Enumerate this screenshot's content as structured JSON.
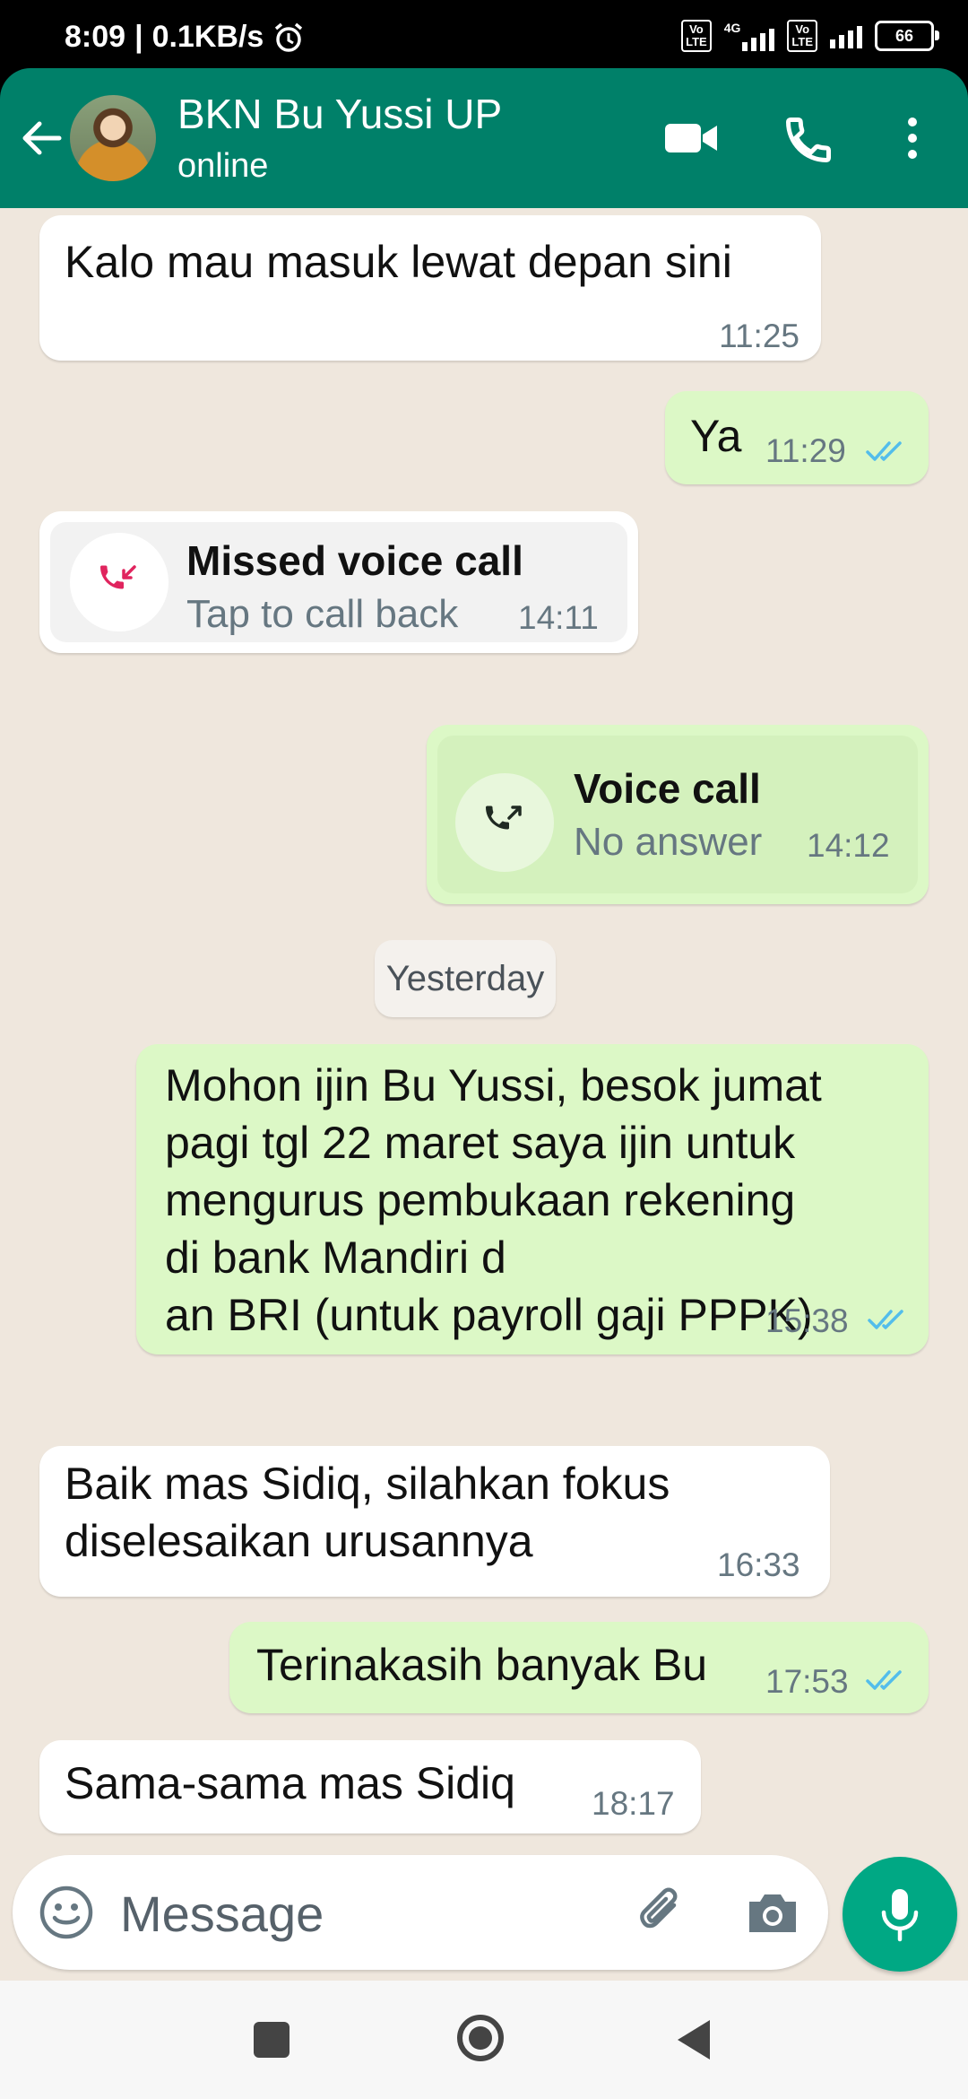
{
  "status_bar": {
    "time": "8:09",
    "speed": "0.1KB/s",
    "network": "4G",
    "volte1": "Vo\nLTE",
    "volte2": "Vo\nLTE",
    "battery": "66"
  },
  "header": {
    "contact_name": "BKN Bu Yussi UP",
    "contact_status": "online",
    "icons": [
      "back-arrow-icon",
      "video-call-icon",
      "voice-call-icon",
      "more-options-icon"
    ]
  },
  "messages": [
    {
      "direction": "in",
      "text": "Kalo mau masuk lewat depan sini",
      "time": "11:25"
    },
    {
      "direction": "out",
      "text": "Ya",
      "time": "11:29",
      "status": "read"
    },
    {
      "direction": "in",
      "type": "call",
      "title": "Missed voice call",
      "subtitle": "Tap to call back",
      "time": "14:11"
    },
    {
      "direction": "out",
      "type": "call",
      "title": "Voice call",
      "subtitle": "No answer",
      "time": "14:12"
    },
    {
      "direction": "out",
      "text": "Mohon ijin Bu Yussi, besok jumat\npagi tgl 22 maret saya ijin untuk\nmengurus pembukaan rekening\ndi bank Mandiri d\nan BRI (untuk payroll gaji PPPK)",
      "time": "15:38",
      "status": "read"
    },
    {
      "direction": "in",
      "text": "Baik mas Sidiq, silahkan fokus\ndiselesaikan urusannya",
      "time": "16:33"
    },
    {
      "direction": "out",
      "text": "Terinakasih banyak Bu",
      "time": "17:53",
      "status": "read"
    },
    {
      "direction": "in",
      "text": "Sama-sama mas Sidiq",
      "time": "18:17"
    }
  ],
  "date_separator": "Yesterday",
  "composer": {
    "placeholder": "Message",
    "icons": [
      "emoji-icon",
      "attach-icon",
      "camera-icon",
      "mic-icon"
    ]
  },
  "colors": {
    "header": "#008069",
    "chat_background": "#efe7dd",
    "outgoing_bubble": "#dcf8c6",
    "incoming_bubble": "#ffffff",
    "read_ticks": "#53bdeb",
    "missed_call": "#e0245e",
    "mic_button": "#00a884"
  }
}
